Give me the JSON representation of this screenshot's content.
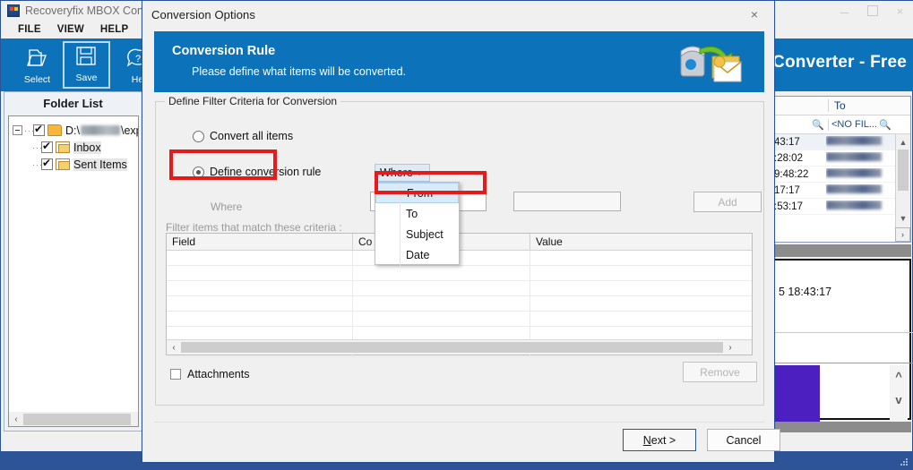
{
  "app": {
    "title": "Recoveryfix MBOX Conve",
    "product_name": "Converter - Free",
    "icon": "app-logo-icon",
    "window_controls": {
      "minimize": "–",
      "maximize": "□",
      "close": "×"
    },
    "menu": [
      {
        "label": "FILE"
      },
      {
        "label": "VIEW"
      },
      {
        "label": "HELP"
      }
    ],
    "ribbon": [
      {
        "label": "Select",
        "icon": "open-folder-icon",
        "selected": false
      },
      {
        "label": "Save",
        "icon": "save-disk-icon",
        "selected": true
      },
      {
        "label": "He",
        "icon": "help-bubble-icon",
        "selected": false
      }
    ],
    "folder_panel": {
      "header": "Folder List",
      "root": {
        "label_prefix": "D:\\",
        "label_suffix": "\\experin",
        "checked": true,
        "expanded": true
      },
      "children": [
        {
          "label": "Inbox",
          "checked": true
        },
        {
          "label": "Sent Items",
          "checked": true
        }
      ]
    },
    "mail_grid": {
      "columns": [
        "",
        "To"
      ],
      "filter_placeholder": "<NO FIL...",
      "search_icon": "magnifier-icon",
      "rows": [
        {
          "date": "43:17",
          "to": ""
        },
        {
          "date": ":28:02",
          "to": ""
        },
        {
          "date": "9:48:22",
          "to": ""
        },
        {
          "date": "17:17",
          "to": ""
        },
        {
          "date": ":53:17",
          "to": ""
        }
      ]
    },
    "preview": {
      "date": "5 18:43:17"
    },
    "scroll": {
      "up": "▲",
      "down": "▼",
      "left": "‹",
      "right": "›"
    }
  },
  "dialog": {
    "title": "Conversion Options",
    "close_label": "×",
    "banner": {
      "title": "Conversion Rule",
      "subtitle": "Please define what items will be converted.",
      "icon": "mailbox-convert-icon"
    },
    "groupbox_legend": "Define Filter Criteria for Conversion",
    "options": [
      {
        "label": "Convert all items",
        "selected": false
      },
      {
        "label": "Define conversion rule",
        "selected": true
      }
    ],
    "where_label": "Where",
    "filter_hint": "Filter items that match these criteria :",
    "where_combo": {
      "value": "Where",
      "caret": "chevron-down-icon"
    },
    "dropdown": {
      "open": true,
      "items": [
        {
          "label": "From",
          "highlighted": true
        },
        {
          "label": "To",
          "highlighted": false
        },
        {
          "label": "Subject",
          "highlighted": false
        },
        {
          "label": "Date",
          "highlighted": false
        }
      ]
    },
    "condition_value": "",
    "value_input": "",
    "add_label": "Add",
    "table": {
      "columns": [
        "Field",
        "Co",
        "Value"
      ],
      "rows": []
    },
    "attachments_label": "Attachments",
    "attachments_checked": false,
    "remove_label": "Remove",
    "next_label_a": "N",
    "next_label_b": "ext >",
    "cancel_label": "Cancel"
  },
  "colors": {
    "accent_blue": "#0c72ba",
    "window_border": "#2c5496",
    "highlight_red": "#e81919",
    "menu_highlight": "#d9ebf9",
    "status_bar": "#2c5496"
  }
}
